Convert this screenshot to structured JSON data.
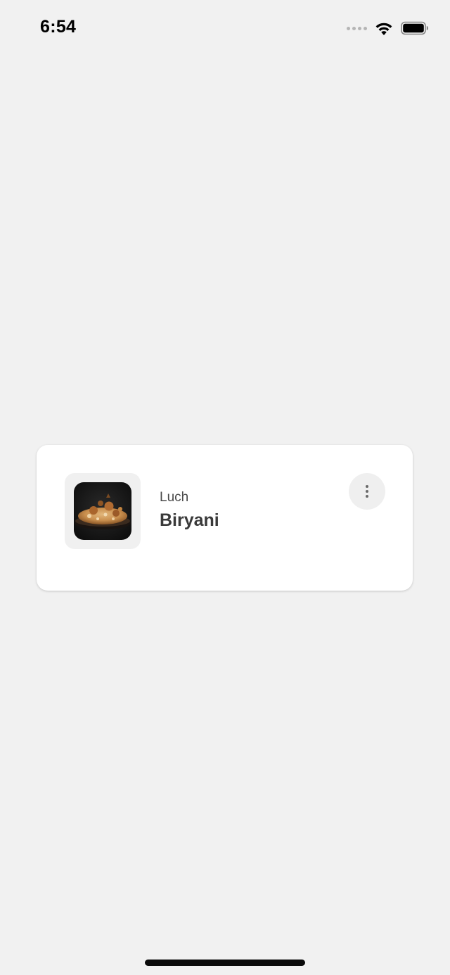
{
  "status_bar": {
    "time": "6:54",
    "icons": [
      "signal-dots-icon",
      "wifi-icon",
      "battery-icon"
    ]
  },
  "meal_card": {
    "meal_type": "Luch",
    "meal_name": "Biryani",
    "image_icon": "biryani-dish-image",
    "menu_icon": "more-vertical-icon"
  },
  "colors": {
    "background": "#f1f1f1",
    "card": "#ffffff",
    "thumb_background": "#f0f0f0",
    "menu_button": "#efefef",
    "text_primary": "#3a3a3a",
    "text_secondary": "#4a4a4a"
  }
}
